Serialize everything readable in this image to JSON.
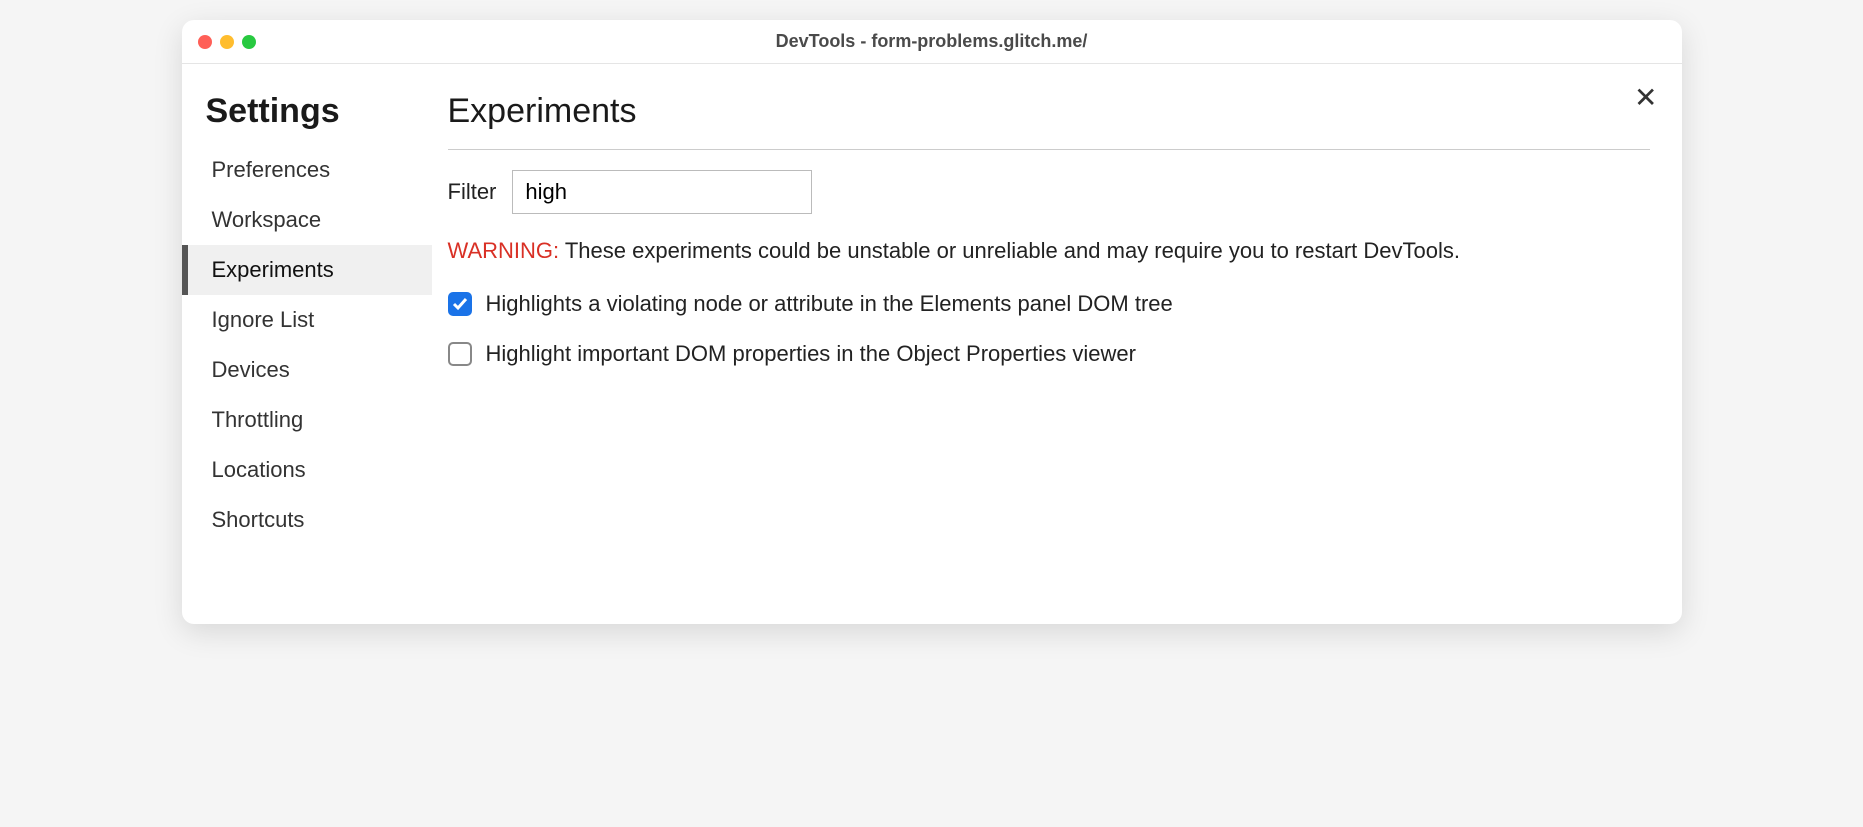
{
  "window": {
    "title": "DevTools - form-problems.glitch.me/"
  },
  "sidebar": {
    "title": "Settings",
    "items": [
      {
        "label": "Preferences",
        "active": false
      },
      {
        "label": "Workspace",
        "active": false
      },
      {
        "label": "Experiments",
        "active": true
      },
      {
        "label": "Ignore List",
        "active": false
      },
      {
        "label": "Devices",
        "active": false
      },
      {
        "label": "Throttling",
        "active": false
      },
      {
        "label": "Locations",
        "active": false
      },
      {
        "label": "Shortcuts",
        "active": false
      }
    ]
  },
  "main": {
    "title": "Experiments",
    "filter_label": "Filter",
    "filter_value": "high",
    "warning_prefix": "WARNING:",
    "warning_text": "These experiments could be unstable or unreliable and may require you to restart DevTools.",
    "experiments": [
      {
        "label": "Highlights a violating node or attribute in the Elements panel DOM tree",
        "checked": true
      },
      {
        "label": "Highlight important DOM properties in the Object Properties viewer",
        "checked": false
      }
    ]
  }
}
